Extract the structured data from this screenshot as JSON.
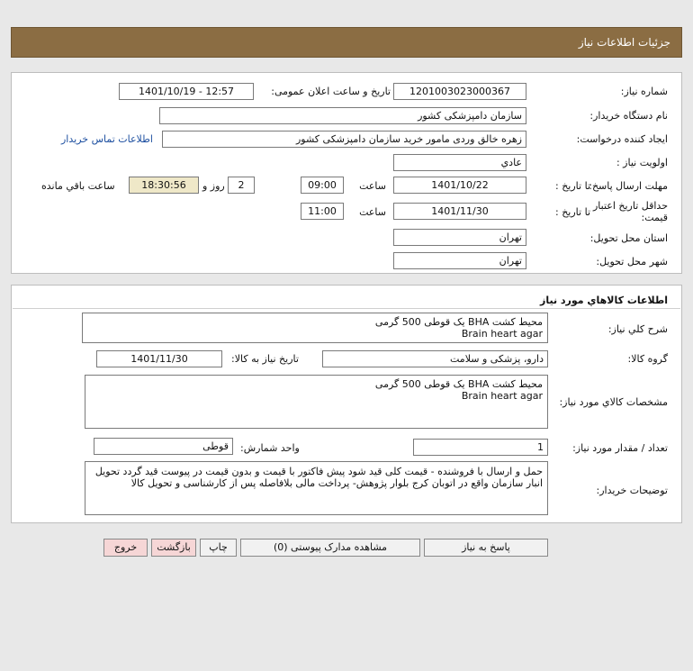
{
  "header": {
    "title": "جزئیات اطلاعات نیاز"
  },
  "details": {
    "need_number_label": "شماره نیاز:",
    "need_number": "1201003023000367",
    "announce_label": "تاریخ و ساعت اعلان عمومی:",
    "announce_value": "1401/10/19 - 12:57",
    "buyer_org_label": "نام دستگاه خریدار:",
    "buyer_org": "سازمان دامپزشکی کشور",
    "creator_label": "ایجاد کننده درخواست:",
    "creator": "زهره خالق وردی مامور خرید سازمان دامپزشکی کشور",
    "contact_link": "اطلاعات تماس خریدار",
    "priority_label": "اولویت نیاز :",
    "priority": "عادي",
    "deadline_label": "مهلت ارسال پاسخ:",
    "to_date_label": "تا تاریخ :",
    "deadline_date": "1401/10/22",
    "time_label": "ساعت",
    "deadline_time": "09:00",
    "days_value": "2",
    "day_and_label": "روز و",
    "remaining_time": "18:30:56",
    "remaining_label": "ساعت باقي مانده",
    "validity_label": "حداقل تاریخ اعتبار قیمت:",
    "validity_date": "1401/11/30",
    "validity_time": "11:00",
    "province_label": "استان محل تحویل:",
    "province": "تهران",
    "city_label": "شهر محل تحویل:",
    "city": "تهران"
  },
  "goods": {
    "section_title": "اطلاعات کالاهاي مورد نياز",
    "general_desc_label": "شرح کلي نياز:",
    "general_desc_line1": "محیط کشت BHA        یک قوطی 500 گرمی",
    "general_desc_line2": "Brain heart  agar",
    "group_label": "گروه کالا:",
    "group_value": "دارو، پزشکی و سلامت",
    "need_date_label": "تاریخ نیاز به کالا:",
    "need_date": "1401/11/30",
    "spec_label": "مشخصات کالاي مورد نياز:",
    "spec_line1": "محیط کشت BHA        یک قوطی 500 گرمی",
    "spec_line2": "Brain heart  agar",
    "qty_label": "تعداد / مقدار مورد نیاز:",
    "qty_value": "1",
    "unit_label": "واحد شمارش:",
    "unit_value": "قوطی",
    "buyer_notes_label": "توضیحات خریدار:",
    "buyer_notes": "حمل و ارسال با فروشنده - قیمت کلی قید شود پیش فاکتور با قیمت و بدون قیمت در پیوست قید گردد  تحویل انبار سازمان واقع در اتوبان کرج بلوار پژوهش- پرداخت مالی بلافاصله پس از کارشناسی و تحویل کالا"
  },
  "buttons": {
    "respond": "پاسخ به نیاز",
    "view_docs": "مشاهده مدارک پیوستی (0)",
    "print": "چاپ",
    "back": "بازگشت",
    "exit": "خروج"
  }
}
